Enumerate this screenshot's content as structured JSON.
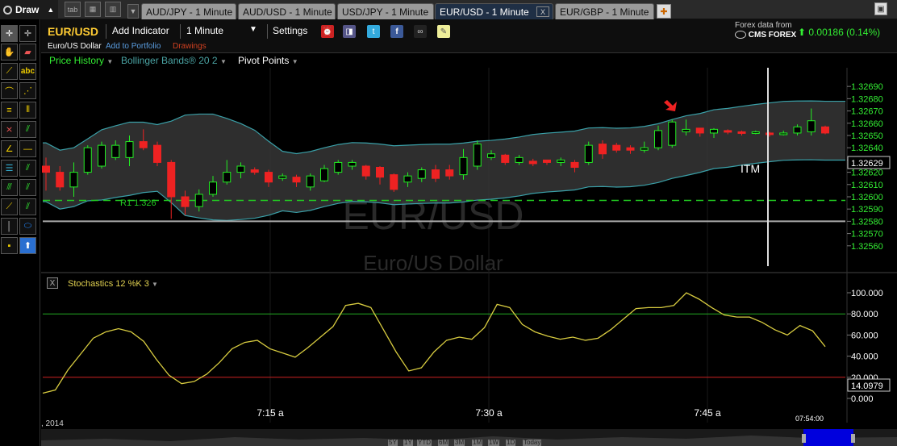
{
  "toolbar": {
    "draw_label": "Draw",
    "tab_icon_label": "tab",
    "tabs": [
      {
        "label": "AUD/JPY - 1 Minute",
        "active": false
      },
      {
        "label": "AUD/USD - 1 Minute",
        "active": false
      },
      {
        "label": "USD/JPY - 1 Minute",
        "active": false
      },
      {
        "label": "EUR/USD - 1 Minute",
        "active": true
      },
      {
        "label": "EUR/GBP - 1 Minute",
        "active": false
      }
    ],
    "close_tab_label": "X"
  },
  "header": {
    "symbol": "EUR/USD",
    "symbol_name": "Euro/US Dollar",
    "add_portfolio": "Add to Portfolio",
    "drawings": "Drawings",
    "add_indicator": "Add Indicator",
    "interval": "1 Minute",
    "settings": "Settings",
    "forex_label": "Forex data from",
    "provider": "CMS FOREX",
    "change": "0.00186 (0.14%)"
  },
  "indicators": {
    "price_history": "Price History",
    "bollinger": "Bollinger Bands® 20 2",
    "pivot": "Pivot Points"
  },
  "chart": {
    "watermark_symbol": "EUR/USD",
    "watermark_name": "Euro/US Dollar",
    "pivot_label": "R1 1.326",
    "itm_label": "ITM",
    "current_price": "1.32629",
    "stoch_label": "Stochastics 12 %K 3",
    "stoch_current": "14.0979",
    "stoch_close_label": "X",
    "date_label": ", 2014",
    "current_time": "07:54:00",
    "range_buttons": [
      "5Y",
      "1Y",
      "YTD",
      "6M",
      "3M",
      "1M",
      "1W",
      "1D",
      "Today"
    ]
  },
  "colors": {
    "up": "#22ee22",
    "down": "#ee2222",
    "band": "#3aa0a8",
    "stoch_line": "#d8cc40",
    "overbought": "#22aa22",
    "oversold": "#cc2222",
    "axis_text": "#33ee33"
  },
  "chart_data": [
    {
      "type": "candlestick",
      "x_ticks": [
        "7:15 a",
        "7:30 a",
        "7:45 a"
      ],
      "y_ticks": [
        1.3269,
        1.3268,
        1.3267,
        1.3266,
        1.3265,
        1.3264,
        1.3263,
        1.3262,
        1.3261,
        1.326,
        1.3259,
        1.3258,
        1.3257,
        1.3256
      ],
      "ylim": [
        1.3255,
        1.32698
      ],
      "pivot_r1": 1.32597,
      "support_line": 1.3258,
      "current_price": 1.32629,
      "ohlc": [
        [
          1.32625,
          1.3262,
          1.32605,
          1.32632
        ],
        [
          1.3262,
          1.32608,
          1.32605,
          1.32625
        ],
        [
          1.32608,
          1.3262,
          1.326,
          1.32628
        ],
        [
          1.3262,
          1.3264,
          1.32618,
          1.32642
        ],
        [
          1.32625,
          1.32642,
          1.32623,
          1.32645
        ],
        [
          1.32632,
          1.32642,
          1.3263,
          1.32646
        ],
        [
          1.32632,
          1.32645,
          1.32625,
          1.3265
        ],
        [
          1.32645,
          1.3264,
          1.32638,
          1.32655
        ],
        [
          1.32642,
          1.32628,
          1.32625,
          1.32645
        ],
        [
          1.32628,
          1.326,
          1.32582,
          1.3263
        ],
        [
          1.326,
          1.32592,
          1.32585,
          1.32605
        ],
        [
          1.32592,
          1.32602,
          1.32588,
          1.32606
        ],
        [
          1.32602,
          1.32612,
          1.326,
          1.32617
        ],
        [
          1.32612,
          1.3262,
          1.3261,
          1.3263
        ],
        [
          1.3262,
          1.32625,
          1.32615,
          1.32628
        ],
        [
          1.32622,
          1.3262,
          1.32618,
          1.32624
        ],
        [
          1.3262,
          1.32612,
          1.32608,
          1.32622
        ],
        [
          1.32615,
          1.32617,
          1.32613,
          1.32619
        ],
        [
          1.32616,
          1.32612,
          1.32608,
          1.32618
        ],
        [
          1.32608,
          1.32617,
          1.32605,
          1.32619
        ],
        [
          1.32613,
          1.32623,
          1.32612,
          1.32626
        ],
        [
          1.3262,
          1.32628,
          1.32618,
          1.3263
        ],
        [
          1.32625,
          1.32628,
          1.32622,
          1.3263
        ],
        [
          1.32625,
          1.32617,
          1.32614,
          1.32626
        ],
        [
          1.32624,
          1.32616,
          1.3261,
          1.32625
        ],
        [
          1.32618,
          1.32606,
          1.32604,
          1.32619
        ],
        [
          1.32612,
          1.32617,
          1.32608,
          1.3262
        ],
        [
          1.32615,
          1.32622,
          1.32612,
          1.32624
        ],
        [
          1.32622,
          1.32615,
          1.32612,
          1.32626
        ],
        [
          1.32622,
          1.32617,
          1.32614,
          1.32626
        ],
        [
          1.32618,
          1.32632,
          1.32614,
          1.32639
        ],
        [
          1.32625,
          1.32643,
          1.32622,
          1.32646
        ],
        [
          1.32632,
          1.32635,
          1.3263,
          1.32638
        ],
        [
          1.32634,
          1.32628,
          1.32626,
          1.32635
        ],
        [
          1.32628,
          1.32632,
          1.32626,
          1.32634
        ],
        [
          1.32629,
          1.32627,
          1.32625,
          1.32631
        ],
        [
          1.3263,
          1.32628,
          1.32626,
          1.3263
        ],
        [
          1.32628,
          1.3263,
          1.32625,
          1.32632
        ],
        [
          1.32628,
          1.32624,
          1.3262,
          1.3263
        ],
        [
          1.32628,
          1.32642,
          1.32626,
          1.32645
        ],
        [
          1.32643,
          1.32635,
          1.32631,
          1.32646
        ],
        [
          1.32642,
          1.32638,
          1.32636,
          1.32644
        ],
        [
          1.3264,
          1.32638,
          1.32635,
          1.32642
        ],
        [
          1.32638,
          1.3264,
          1.32636,
          1.32645
        ],
        [
          1.3264,
          1.32654,
          1.32638,
          1.32658
        ],
        [
          1.32642,
          1.32661,
          1.3264,
          1.32663
        ],
        [
          1.32653,
          1.32655,
          1.3265,
          1.32663
        ],
        [
          1.32656,
          1.32652,
          1.32649,
          1.32656
        ],
        [
          1.32652,
          1.32655,
          1.32648,
          1.32656
        ],
        [
          1.32654,
          1.32653,
          1.32651,
          1.32655
        ],
        [
          1.32653,
          1.32652,
          1.3265,
          1.32654
        ],
        [
          1.32652,
          1.32653,
          1.32651,
          1.32654
        ],
        [
          1.32652,
          1.32651,
          1.32649,
          1.32653
        ],
        [
          1.32651,
          1.32652,
          1.3265,
          1.32654
        ],
        [
          1.32652,
          1.32657,
          1.3265,
          1.32659
        ],
        [
          1.32653,
          1.32662,
          1.3265,
          1.32672
        ],
        [
          1.32657,
          1.32652,
          1.32651,
          1.32658
        ]
      ]
    },
    {
      "type": "line",
      "name": "Stochastics 12 %K 3",
      "ylim": [
        0,
        100
      ],
      "y_ticks": [
        0,
        20,
        40,
        60,
        80,
        100
      ],
      "overbought": 80,
      "oversold": 20,
      "values": [
        5,
        8,
        27,
        42,
        57,
        63,
        66,
        63,
        54,
        37,
        22,
        14,
        16,
        23,
        34,
        47,
        53,
        55,
        47,
        43,
        39,
        48,
        58,
        68,
        88,
        90,
        86,
        65,
        44,
        26,
        29,
        44,
        55,
        58,
        56,
        67,
        89,
        86,
        70,
        63,
        59,
        56,
        58,
        55,
        57,
        65,
        75,
        85,
        86,
        86,
        88,
        100,
        94,
        86,
        79,
        77,
        77,
        72,
        65,
        60,
        69,
        64,
        49
      ]
    }
  ]
}
